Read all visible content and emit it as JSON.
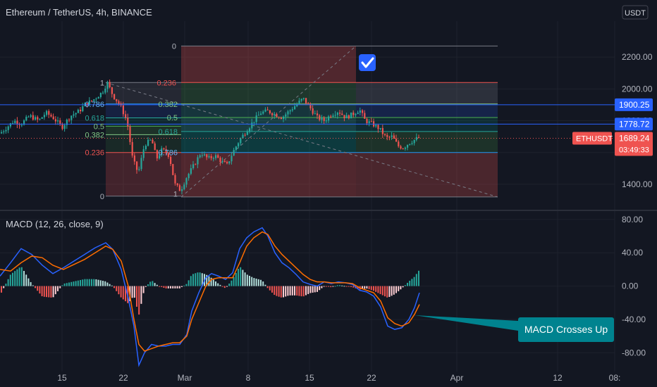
{
  "header": {
    "symbol_title": "Ethereum / TetherUS, 4h, BINANCE",
    "currency_badge": "USDT",
    "check_icon": "checkmark-icon"
  },
  "indicator": {
    "label": "MACD (12, 26, close, 9)",
    "annotation": "MACD Crosses Up"
  },
  "colors": {
    "background": "#131722",
    "grid": "#1e222d",
    "text": "#b2b5be",
    "up": "#26a69a",
    "down": "#ef5350",
    "macd_line": "#2962ff",
    "signal_line": "#ff6d00",
    "hline": "#2962ff",
    "annotation_bg": "#00838f",
    "price_tag": "#ef5350"
  },
  "chart_data": [
    {
      "type": "candlestick",
      "series": [
        {
          "name": "ETHUSDT",
          "last": "1689.24",
          "countdown": "03:49:33"
        }
      ],
      "y_ticks": [
        "2200.00",
        "2000.00",
        "1800.00",
        "1600.00",
        "1400.00"
      ],
      "x_ticks": [
        "15",
        "22",
        "Mar",
        "8",
        "15",
        "22",
        "Apr",
        "12",
        "08:"
      ],
      "ylim": [
        1240,
        2400
      ],
      "horizontal_levels": [
        "1900.25",
        "1778.72"
      ],
      "fib_left": {
        "levels": [
          "1",
          "0.786",
          "0.618",
          "0.5",
          "0.382",
          "0.236",
          "0"
        ],
        "values": [
          2040,
          1905,
          1818,
          1765,
          1712,
          1600,
          1325
        ]
      },
      "fib_mid": {
        "levels": [
          "0.382",
          "0.5",
          "0.618",
          "0.786",
          "1"
        ],
        "values": [
          1905,
          1820,
          1732,
          1600,
          1340
        ]
      },
      "fib_top": {
        "levels": [
          "0",
          "0.236",
          "0.382",
          "0.5",
          "0.618",
          "0.786",
          "1"
        ],
        "values": [
          2270,
          2040,
          1905,
          1820,
          1732,
          1600,
          1320
        ]
      },
      "close_path": [
        [
          0,
          1720
        ],
        [
          10,
          1760
        ],
        [
          20,
          1800
        ],
        [
          30,
          1780
        ],
        [
          42,
          1830
        ],
        [
          55,
          1800
        ],
        [
          65,
          1850
        ],
        [
          75,
          1820
        ],
        [
          88,
          1760
        ],
        [
          100,
          1830
        ],
        [
          112,
          1860
        ],
        [
          120,
          1900
        ],
        [
          132,
          1930
        ],
        [
          145,
          1980
        ],
        [
          152,
          2040
        ],
        [
          160,
          1960
        ],
        [
          170,
          1900
        ],
        [
          180,
          1800
        ],
        [
          188,
          1560
        ],
        [
          196,
          1470
        ],
        [
          205,
          1650
        ],
        [
          215,
          1680
        ],
        [
          222,
          1560
        ],
        [
          230,
          1620
        ],
        [
          240,
          1580
        ],
        [
          248,
          1400
        ],
        [
          256,
          1360
        ],
        [
          264,
          1440
        ],
        [
          275,
          1520
        ],
        [
          285,
          1600
        ],
        [
          295,
          1560
        ],
        [
          305,
          1580
        ],
        [
          315,
          1540
        ],
        [
          322,
          1520
        ],
        [
          330,
          1600
        ],
        [
          340,
          1680
        ],
        [
          350,
          1740
        ],
        [
          360,
          1800
        ],
        [
          370,
          1850
        ],
        [
          380,
          1860
        ],
        [
          390,
          1840
        ],
        [
          400,
          1820
        ],
        [
          410,
          1860
        ],
        [
          420,
          1900
        ],
        [
          430,
          1940
        ],
        [
          440,
          1880
        ],
        [
          450,
          1820
        ],
        [
          460,
          1800
        ],
        [
          470,
          1840
        ],
        [
          480,
          1860
        ],
        [
          490,
          1820
        ],
        [
          500,
          1840
        ],
        [
          510,
          1870
        ],
        [
          518,
          1800
        ],
        [
          528,
          1780
        ],
        [
          538,
          1750
        ],
        [
          548,
          1690
        ],
        [
          556,
          1700
        ],
        [
          565,
          1640
        ],
        [
          572,
          1630
        ],
        [
          580,
          1660
        ],
        [
          588,
          1680
        ],
        [
          595,
          1695
        ]
      ],
      "position_tool": {
        "entry": "1657",
        "target": "2040",
        "stop": "1320",
        "start_x": 257,
        "end_x": 505,
        "ext_x": 706
      }
    },
    {
      "type": "line",
      "title": "MACD (12, 26, close, 9)",
      "y_ticks": [
        "80.00",
        "40.00",
        "0.00",
        "-40.00",
        "-80.00"
      ],
      "ylim": [
        -100,
        90
      ],
      "series": [
        {
          "name": "MACD",
          "values": [
            [
              0,
              12
            ],
            [
              15,
              28
            ],
            [
              30,
              45
            ],
            [
              45,
              38
            ],
            [
              60,
              25
            ],
            [
              75,
              15
            ],
            [
              90,
              22
            ],
            [
              105,
              30
            ],
            [
              120,
              38
            ],
            [
              135,
              46
            ],
            [
              150,
              52
            ],
            [
              160,
              44
            ],
            [
              172,
              20
            ],
            [
              182,
              -15
            ],
            [
              190,
              -48
            ],
            [
              197,
              -95
            ],
            [
              205,
              -80
            ],
            [
              215,
              -70
            ],
            [
              225,
              -72
            ],
            [
              235,
              -72
            ],
            [
              245,
              -70
            ],
            [
              255,
              -70
            ],
            [
              265,
              -58
            ],
            [
              272,
              -30
            ],
            [
              282,
              -8
            ],
            [
              292,
              10
            ],
            [
              300,
              15
            ],
            [
              310,
              12
            ],
            [
              320,
              8
            ],
            [
              330,
              16
            ],
            [
              340,
              45
            ],
            [
              350,
              58
            ],
            [
              360,
              65
            ],
            [
              372,
              70
            ],
            [
              380,
              60
            ],
            [
              390,
              40
            ],
            [
              400,
              28
            ],
            [
              410,
              22
            ],
            [
              420,
              14
            ],
            [
              430,
              5
            ],
            [
              440,
              2
            ],
            [
              450,
              0
            ],
            [
              460,
              5
            ],
            [
              470,
              3
            ],
            [
              480,
              5
            ],
            [
              490,
              4
            ],
            [
              500,
              2
            ],
            [
              510,
              -5
            ],
            [
              520,
              -7
            ],
            [
              530,
              -12
            ],
            [
              540,
              -25
            ],
            [
              550,
              -48
            ],
            [
              560,
              -52
            ],
            [
              570,
              -50
            ],
            [
              580,
              -40
            ],
            [
              588,
              -26
            ],
            [
              595,
              -8
            ]
          ]
        },
        {
          "name": "Signal",
          "values": [
            [
              0,
              20
            ],
            [
              15,
              18
            ],
            [
              30,
              28
            ],
            [
              45,
              36
            ],
            [
              60,
              34
            ],
            [
              75,
              25
            ],
            [
              90,
              20
            ],
            [
              105,
              26
            ],
            [
              120,
              32
            ],
            [
              135,
              40
            ],
            [
              150,
              48
            ],
            [
              160,
              44
            ],
            [
              172,
              30
            ],
            [
              182,
              0
            ],
            [
              190,
              -40
            ],
            [
              197,
              -70
            ],
            [
              205,
              -78
            ],
            [
              215,
              -75
            ],
            [
              225,
              -72
            ],
            [
              235,
              -70
            ],
            [
              245,
              -68
            ],
            [
              255,
              -68
            ],
            [
              265,
              -60
            ],
            [
              272,
              -40
            ],
            [
              282,
              -20
            ],
            [
              292,
              0
            ],
            [
              300,
              8
            ],
            [
              310,
              10
            ],
            [
              320,
              10
            ],
            [
              330,
              10
            ],
            [
              340,
              28
            ],
            [
              350,
              48
            ],
            [
              360,
              58
            ],
            [
              372,
              65
            ],
            [
              380,
              62
            ],
            [
              390,
              48
            ],
            [
              400,
              38
            ],
            [
              410,
              30
            ],
            [
              420,
              22
            ],
            [
              430,
              14
            ],
            [
              440,
              8
            ],
            [
              450,
              5
            ],
            [
              460,
              5
            ],
            [
              470,
              4
            ],
            [
              480,
              4
            ],
            [
              490,
              4
            ],
            [
              500,
              3
            ],
            [
              510,
              -2
            ],
            [
              520,
              -5
            ],
            [
              530,
              -8
            ],
            [
              540,
              -18
            ],
            [
              550,
              -38
            ],
            [
              560,
              -45
            ],
            [
              570,
              -48
            ],
            [
              580,
              -44
            ],
            [
              588,
              -34
            ],
            [
              595,
              -22
            ]
          ]
        }
      ]
    }
  ]
}
